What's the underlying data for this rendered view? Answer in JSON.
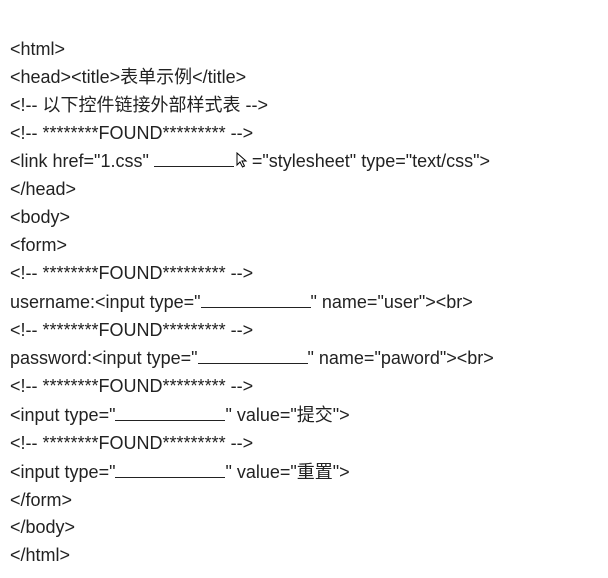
{
  "code": {
    "l1": "<html>",
    "l2a": "<head><title>",
    "l2b": "表单示例",
    "l2c": "</title>",
    "l3a": "<!-- ",
    "l3b": "以下控件链接外部样式表",
    "l3c": " -->",
    "l4": "<!-- ********FOUND********* -->",
    "l5a": "<link href=\"1.css\"",
    "l5c": "=\"stylesheet\" type=\"text/css\">",
    "l6": "</head>",
    "l7": "<body>",
    "l8": "<form>",
    "l9": "<!-- ********FOUND********* -->",
    "l10a": "username:<input type=\"",
    "l10b": "\" name=\"user\"><br>",
    "l11": "<!-- ********FOUND********* -->",
    "l12a": "password:<input type=\"",
    "l12b": "\" name=\"paword\"><br>",
    "l13": "<!-- ********FOUND********* -->",
    "l14a": "<input type=\"",
    "l14b": "\" value=\"",
    "l14c": "提交",
    "l14d": "\">",
    "l15": "<!-- ********FOUND********* -->",
    "l16a": "<input type=\"",
    "l16b": "\" value=\"",
    "l16c": "重置",
    "l16d": "\">",
    "l17": "</form>",
    "l18": "</body>",
    "l19": "</html>"
  },
  "blanks": {
    "link_attr": 80,
    "username_type": 110,
    "password_type": 110,
    "submit_type": 110,
    "reset_type": 110
  }
}
